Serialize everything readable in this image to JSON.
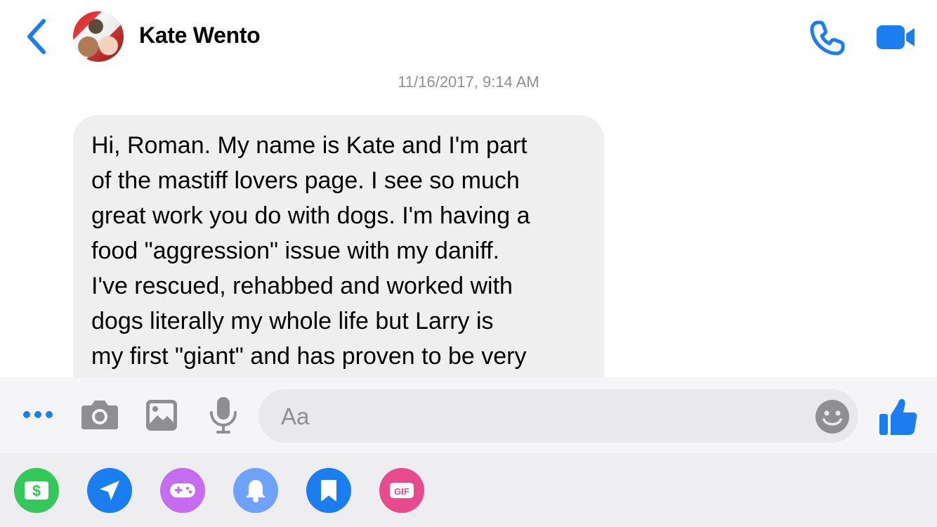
{
  "header": {
    "contact_name": "Kate Wento",
    "accent_color": "#1a7df0"
  },
  "thread": {
    "timestamp": "11/16/2017, 9:14 AM",
    "messages": [
      {
        "sender": "Kate Wento",
        "text": "Hi, Roman. My name is Kate and I'm part\nof the mastiff lovers page. I see so much\ngreat work you do with dogs. I'm having a\nfood \"aggression\" issue with my daniff.\nI've rescued, rehabbed and worked with\ndogs literally my whole life but Larry is\nmy first \"giant\" and has proven to be very"
      }
    ]
  },
  "composer": {
    "placeholder": "Aa",
    "icons": [
      "more-icon",
      "camera-icon",
      "photo-icon",
      "microphone-icon",
      "emoji-icon",
      "thumbs-up-icon"
    ]
  },
  "tray": {
    "apps": [
      {
        "name": "payments",
        "icon": "dollar-icon",
        "color": "#34c759"
      },
      {
        "name": "location",
        "icon": "send-location-icon",
        "color": "#1a7df0"
      },
      {
        "name": "games",
        "icon": "gamepad-icon",
        "color": "#c56cf0"
      },
      {
        "name": "reminders",
        "icon": "bell-icon",
        "color": "#6ea2ff"
      },
      {
        "name": "saved",
        "icon": "bookmark-icon",
        "color": "#1a7df0"
      },
      {
        "name": "gif",
        "icon": "gif-icon",
        "color": "#e84a8e",
        "label": "GIF"
      }
    ]
  }
}
